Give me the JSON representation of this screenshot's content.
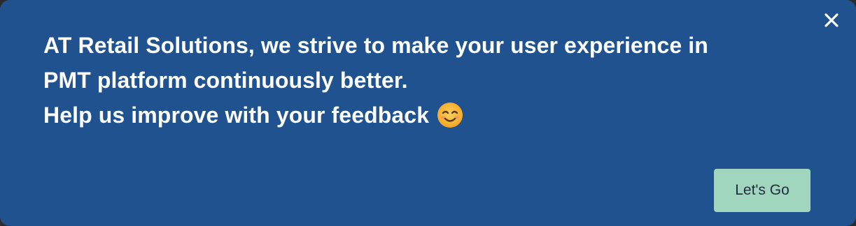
{
  "banner": {
    "background_color": "#20528f",
    "text_color": "#ffffff",
    "lines": [
      "AT Retail Solutions, we strive to make your user experience in",
      "PMT platform continuously better.",
      "Help us improve with your feedback"
    ],
    "emoji_icon": "smiling-face-icon",
    "close_icon": "close-icon",
    "cta_label": "Let's Go",
    "cta_color": "#9fd6bd"
  }
}
